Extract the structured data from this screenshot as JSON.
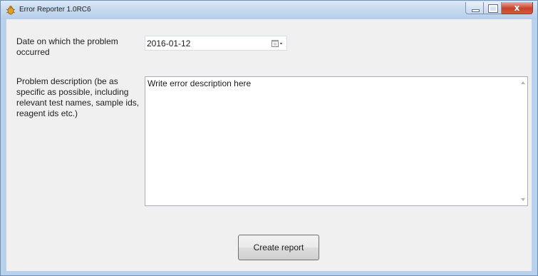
{
  "window": {
    "title": "Error Reporter 1.0RC6",
    "icon": "bug-app-icon",
    "caption_buttons": [
      "minimize-icon",
      "maximize-icon",
      "close-icon"
    ],
    "close_glyph": "x"
  },
  "form": {
    "date_label": "Date on which the problem occurred",
    "date_value": "2016-01-12",
    "date_button_icon": "calendar-dropdown-icon",
    "description_label": "Problem description (be as specific as possible, including relevant test names, sample ids, reagent ids etc.)",
    "description_value": "Write error description here",
    "submit_label": "Create report"
  },
  "colors": {
    "window_frame": "#b9d1ea",
    "client_background": "#f0f0f0",
    "close_button": "#c9402a"
  }
}
